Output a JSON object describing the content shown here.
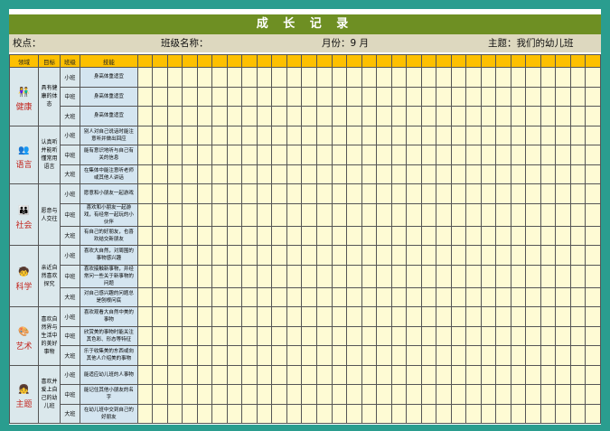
{
  "title": "成 长 记 录",
  "info": {
    "school": "校点：",
    "class_name": "班级名称：",
    "month": "月份：9 月",
    "theme": "主题：我们的幼儿班"
  },
  "headers": {
    "area": "领域",
    "goal": "目标",
    "class": "班级",
    "skill": "技能"
  },
  "grid_columns": 31,
  "groups": [
    {
      "area": "健康",
      "icon": "kids-icon",
      "goal": "具有健康的体态",
      "rows": [
        {
          "class": "小班",
          "skill": "身高体重适宜"
        },
        {
          "class": "中班",
          "skill": "身高体重适宜"
        },
        {
          "class": "大班",
          "skill": "身高体重适宜"
        }
      ]
    },
    {
      "area": "语言",
      "icon": "people-icon",
      "goal": "认真听并能听懂常用语言",
      "rows": [
        {
          "class": "小班",
          "skill": "别人对自己说话时能注意听并做出回应"
        },
        {
          "class": "中班",
          "skill": "能有意识地听与自己有关的信息"
        },
        {
          "class": "大班",
          "skill": "在集体中能注意听老师或其他人讲话"
        }
      ]
    },
    {
      "area": "社会",
      "icon": "friends-icon",
      "goal": "愿意与人交往",
      "rows": [
        {
          "class": "小班",
          "skill": "愿意和小朋友一起游戏"
        },
        {
          "class": "中班",
          "skill": "喜欢和小朋友一起游戏，有经常一起玩的小伙伴"
        },
        {
          "class": "大班",
          "skill": "有自己的好朋友，也喜欢结交新朋友"
        }
      ]
    },
    {
      "area": "科学",
      "icon": "explore-icon",
      "goal": "亲近自然喜欢探究",
      "rows": [
        {
          "class": "小班",
          "skill": "喜欢大自然，对周围的事物感兴趣"
        },
        {
          "class": "中班",
          "skill": "喜欢接触新事物，并经常问一些关于新事物的问题"
        },
        {
          "class": "大班",
          "skill": "对自己感兴趣的问题总是刨根问底"
        }
      ]
    },
    {
      "area": "艺术",
      "icon": "art-icon",
      "goal": "喜欢自然界与生活中的美好事物",
      "rows": [
        {
          "class": "小班",
          "skill": "喜欢观看大自然中美的事物"
        },
        {
          "class": "中班",
          "skill": "欣赏美的事物时能关注其色彩、形态等特征"
        },
        {
          "class": "大班",
          "skill": "乐于收集美的东西或向其他人介绍美的事物"
        }
      ]
    },
    {
      "area": "主题",
      "icon": "theme-icon",
      "goal": "喜欢并爱上自己的幼儿班",
      "rows": [
        {
          "class": "小班",
          "skill": "能适应幼儿班的人事物"
        },
        {
          "class": "中班",
          "skill": "能记住其他小朋友的名字"
        },
        {
          "class": "大班",
          "skill": "在幼儿班中交到自己的好朋友"
        }
      ]
    }
  ]
}
